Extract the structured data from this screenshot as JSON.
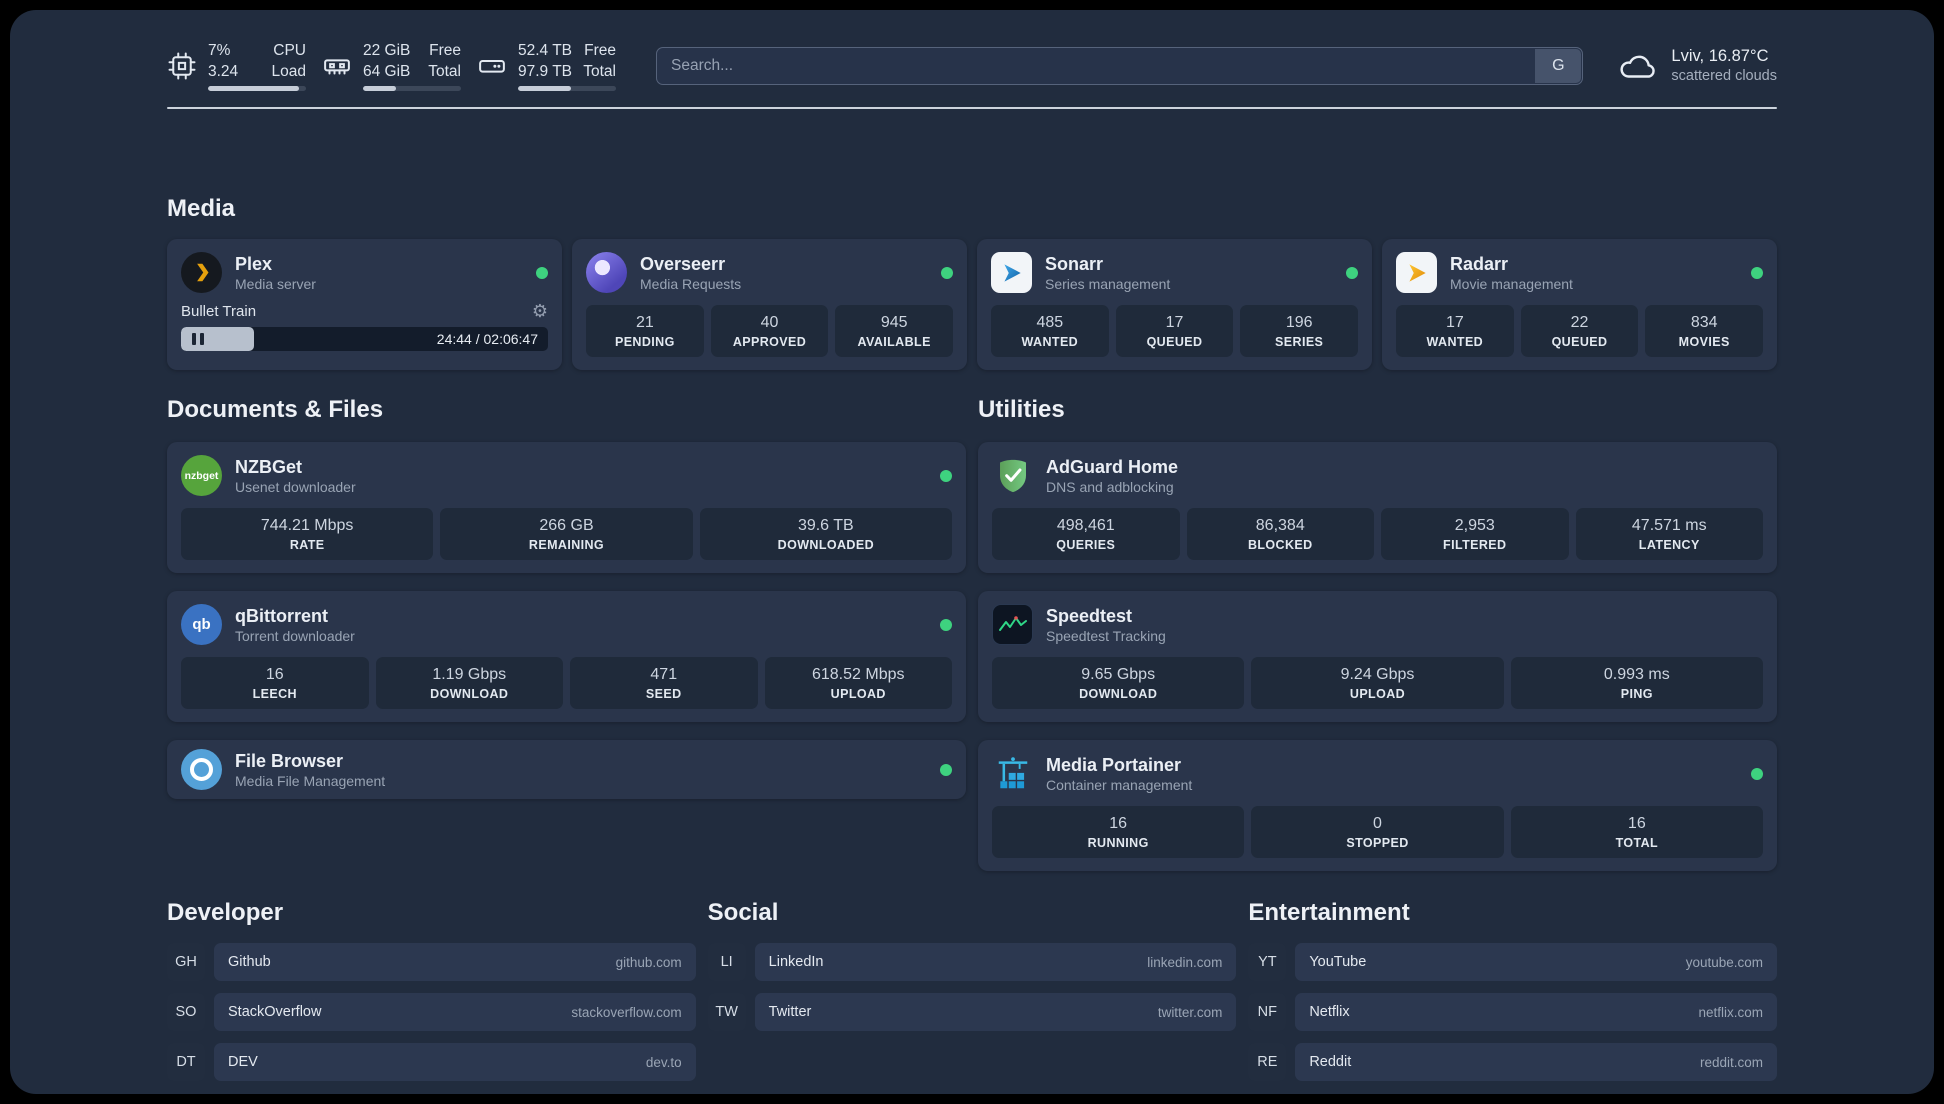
{
  "topbar": {
    "cpu": {
      "value1": "7%",
      "label1": "CPU",
      "value2": "3.24",
      "label2": "Load",
      "bar": "width:93%"
    },
    "ram": {
      "value1": "22 GiB",
      "label1": "Free",
      "value2": "64 GiB",
      "label2": "Total",
      "bar": "width:34%"
    },
    "disk": {
      "value1": "52.4 TB",
      "label1": "Free",
      "value2": "97.9 TB",
      "label2": "Total",
      "bar": "width:54%"
    },
    "search": {
      "placeholder": "Search...",
      "provider": "G"
    },
    "weather": {
      "location": "Lviv, 16.87°C",
      "condition": "scattered clouds"
    }
  },
  "sections": {
    "media": "Media",
    "documents": "Documents & Files",
    "utilities": "Utilities",
    "developer": "Developer",
    "social": "Social",
    "entertainment": "Entertainment"
  },
  "services": {
    "plex": {
      "name": "Plex",
      "desc": "Media server",
      "now_playing": "Bullet Train",
      "time": "24:44 / 02:06:47",
      "progress": "width:20%"
    },
    "overseerr": {
      "name": "Overseerr",
      "desc": "Media Requests",
      "stats": [
        {
          "value": "21",
          "label": "PENDING"
        },
        {
          "value": "40",
          "label": "APPROVED"
        },
        {
          "value": "945",
          "label": "AVAILABLE"
        }
      ]
    },
    "sonarr": {
      "name": "Sonarr",
      "desc": "Series management",
      "stats": [
        {
          "value": "485",
          "label": "WANTED"
        },
        {
          "value": "17",
          "label": "QUEUED"
        },
        {
          "value": "196",
          "label": "SERIES"
        }
      ]
    },
    "radarr": {
      "name": "Radarr",
      "desc": "Movie management",
      "stats": [
        {
          "value": "17",
          "label": "WANTED"
        },
        {
          "value": "22",
          "label": "QUEUED"
        },
        {
          "value": "834",
          "label": "MOVIES"
        }
      ]
    },
    "nzbget": {
      "name": "NZBGet",
      "desc": "Usenet downloader",
      "icon_text": "nzbget",
      "stats": [
        {
          "value": "744.21 Mbps",
          "label": "RATE"
        },
        {
          "value": "266 GB",
          "label": "REMAINING"
        },
        {
          "value": "39.6 TB",
          "label": "DOWNLOADED"
        }
      ]
    },
    "qbittorrent": {
      "name": "qBittorrent",
      "desc": "Torrent downloader",
      "icon_text": "qb",
      "stats": [
        {
          "value": "16",
          "label": "LEECH"
        },
        {
          "value": "1.19 Gbps",
          "label": "DOWNLOAD"
        },
        {
          "value": "471",
          "label": "SEED"
        },
        {
          "value": "618.52 Mbps",
          "label": "UPLOAD"
        }
      ]
    },
    "filebrowser": {
      "name": "File Browser",
      "desc": "Media File Management"
    },
    "adguard": {
      "name": "AdGuard Home",
      "desc": "DNS and adblocking",
      "stats": [
        {
          "value": "498,461",
          "label": "QUERIES"
        },
        {
          "value": "86,384",
          "label": "BLOCKED"
        },
        {
          "value": "2,953",
          "label": "FILTERED"
        },
        {
          "value": "47.571 ms",
          "label": "LATENCY"
        }
      ]
    },
    "speedtest": {
      "name": "Speedtest",
      "desc": "Speedtest Tracking",
      "stats": [
        {
          "value": "9.65 Gbps",
          "label": "DOWNLOAD"
        },
        {
          "value": "9.24 Gbps",
          "label": "UPLOAD"
        },
        {
          "value": "0.993 ms",
          "label": "PING"
        }
      ]
    },
    "portainer": {
      "name": "Media Portainer",
      "desc": "Container management",
      "stats": [
        {
          "value": "16",
          "label": "RUNNING"
        },
        {
          "value": "0",
          "label": "STOPPED"
        },
        {
          "value": "16",
          "label": "TOTAL"
        }
      ]
    }
  },
  "bookmarks": {
    "developer": [
      {
        "abbr": "GH",
        "name": "Github",
        "href": "github.com"
      },
      {
        "abbr": "SO",
        "name": "StackOverflow",
        "href": "stackoverflow.com"
      },
      {
        "abbr": "DT",
        "name": "DEV",
        "href": "dev.to"
      }
    ],
    "social": [
      {
        "abbr": "LI",
        "name": "LinkedIn",
        "href": "linkedin.com"
      },
      {
        "abbr": "TW",
        "name": "Twitter",
        "href": "twitter.com"
      }
    ],
    "entertainment": [
      {
        "abbr": "YT",
        "name": "YouTube",
        "href": "youtube.com"
      },
      {
        "abbr": "NF",
        "name": "Netflix",
        "href": "netflix.com"
      },
      {
        "abbr": "RE",
        "name": "Reddit",
        "href": "reddit.com"
      }
    ]
  },
  "colors": {
    "status_online": "#3ed27f",
    "plex_accent": "#e5a00d",
    "panel_bg": "#212c3e",
    "card_bg": "#2a354b",
    "stat_bg": "#1f2a3a"
  }
}
